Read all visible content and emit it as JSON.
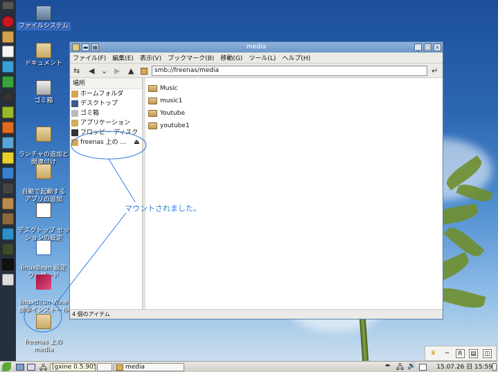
{
  "desktop": {
    "icons": [
      {
        "label": "ファイルシステム"
      },
      {
        "label": "ドキュメント"
      },
      {
        "label": "ゴミ箱"
      },
      {
        "label": "ランチャの追加と\n関連付け"
      },
      {
        "label": "自動で起動する\nアプリの追加"
      },
      {
        "label": "デスクトップ セッ\nションの設定"
      },
      {
        "label": "linuxBean 設定\nウィザード"
      },
      {
        "label": "linuxBean Wine\n簡単インストール"
      },
      {
        "label": "freenas 上の\nmedia"
      }
    ]
  },
  "window": {
    "title": "media",
    "menu": [
      "ファイル(F)",
      "編集(E)",
      "表示(V)",
      "ブックマーク(B)",
      "移動(G)",
      "ツール(L)",
      "ヘルプ(H)"
    ],
    "path": "smb://freenas/media",
    "sidebar": {
      "header": "場所",
      "items": [
        "ホームフォルダ",
        "デスクトップ",
        "ゴミ箱",
        "アプリケーション",
        "フロッピー ディスク",
        "freenas 上の …"
      ]
    },
    "files": [
      "Music",
      "music1",
      "Youtube",
      "youtube1"
    ],
    "status": "4 個のアイテム"
  },
  "annotation": "マウントされました。",
  "taskbar": {
    "tasks": [
      "[gxine 0.5.905]",
      "media"
    ],
    "clock": "15.07.26 日 15:59"
  },
  "colors": {
    "annotation": "#2a7ce0",
    "titlebar": "#7ea6d2"
  }
}
